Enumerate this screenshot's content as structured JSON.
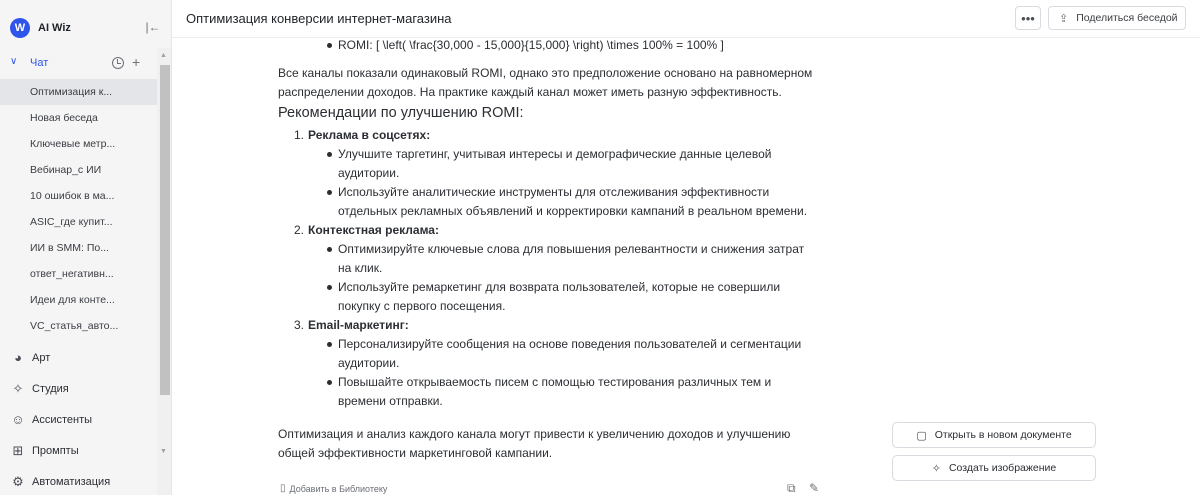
{
  "brand": {
    "name": "AI Wiz",
    "logo_letter": "W"
  },
  "sidebar": {
    "section": {
      "label": "Чат"
    },
    "chats": [
      "Оптимизация к...",
      "Новая беседа",
      "Ключевые метр...",
      "Вебинар_с ИИ",
      "10 ошибок в ма...",
      "ASIC_где купит...",
      "ИИ в SMM: По...",
      "ответ_негативн...",
      "Идеи для конте...",
      "VC_статья_авто..."
    ],
    "nav": [
      {
        "label": "Арт",
        "icon": "palette-icon"
      },
      {
        "label": "Студия",
        "icon": "sparkle-icon"
      },
      {
        "label": "Ассистенты",
        "icon": "assistant-icon"
      },
      {
        "label": "Промпты",
        "icon": "grid-icon"
      },
      {
        "label": "Автоматизация",
        "icon": "automation-icon"
      }
    ]
  },
  "header": {
    "title": "Оптимизация конверсии интернет-магазина",
    "more": "•••",
    "share_label": "Поделиться беседой"
  },
  "message": {
    "romi_line": "ROMI: [ \\left( \\frac{30,000 - 15,000}{15,000} \\right) \\times 100% = 100% ]",
    "paragraph1_l1": "Все каналы показали одинаковый ROMI, однако это предположение основано на равномерном",
    "paragraph1_l2": "распределении доходов. На практике каждый канал может иметь разную эффективность.",
    "heading": "Рекомендации по улучшению ROMI:",
    "items": [
      {
        "num": "1.",
        "title": "Реклама в соцсетях:",
        "lines": [
          "Улучшите таргетинг, учитывая интересы и демографические данные целевой",
          "аудитории.",
          "Используйте аналитические инструменты для отслеживания эффективности",
          "отдельных рекламных объявлений и корректировки кампаний в реальном времени."
        ]
      },
      {
        "num": "2.",
        "title": "Контекстная реклама:",
        "lines": [
          "Оптимизируйте ключевые слова для повышения релевантности и снижения затрат",
          "на клик.",
          "Используйте ремаркетинг для возврата пользователей, которые не совершили",
          "покупку с первого посещения."
        ]
      },
      {
        "num": "3.",
        "title": "Email-маркетинг:",
        "lines": [
          "Персонализируйте сообщения на основе поведения пользователей и сегментации",
          "аудитории.",
          "Повышайте открываемость писем с помощью тестирования различных тем и",
          "времени отправки."
        ]
      }
    ],
    "conclusion_l1": "Оптимизация и анализ каждого канала могут привести к увеличению доходов и улучшению",
    "conclusion_l2": "общей эффективности маркетинговой кампании.",
    "add_to_library": "Добавить в Библиотеку"
  },
  "actions": {
    "open_doc": "Открыть в новом документе",
    "create_image": "Создать изображение"
  },
  "colors": {
    "accent": "#2f54eb",
    "sidebar_bg": "#f5f5f6",
    "active_item": "#e4e5e8"
  }
}
